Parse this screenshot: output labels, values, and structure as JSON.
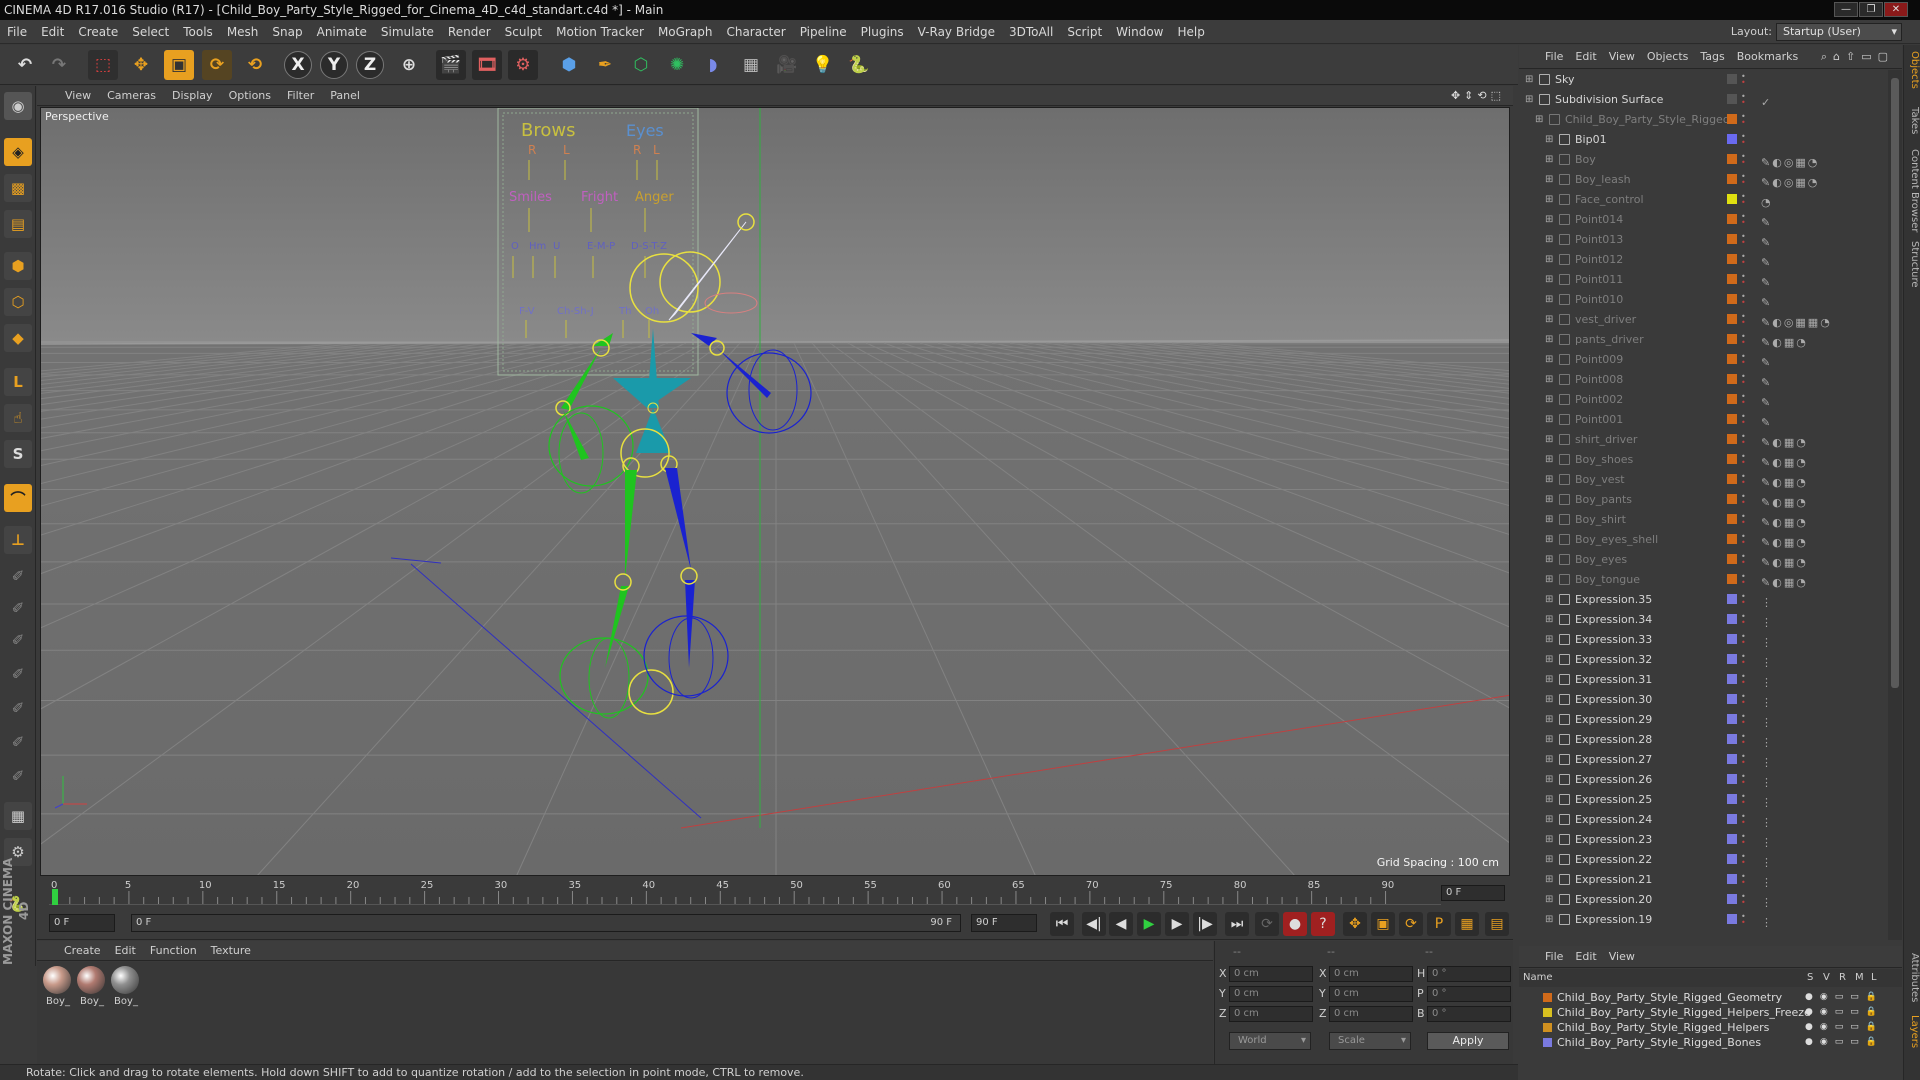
{
  "window": {
    "title": "CINEMA 4D R17.016 Studio (R17) - [Child_Boy_Party_Style_Rigged_for_Cinema_4D_c4d_standart.c4d *] - Main"
  },
  "menubar": {
    "items": [
      "File",
      "Edit",
      "Create",
      "Select",
      "Tools",
      "Mesh",
      "Snap",
      "Animate",
      "Simulate",
      "Render",
      "Sculpt",
      "Motion Tracker",
      "MoGraph",
      "Character",
      "Pipeline",
      "Plugins",
      "V-Ray Bridge",
      "3DToAll",
      "Script",
      "Window",
      "Help"
    ],
    "layout_label": "Layout:",
    "layout_value": "Startup (User)"
  },
  "toolbar": {
    "axis_x": "X",
    "axis_y": "Y",
    "axis_z": "Z"
  },
  "viewport": {
    "menu": [
      "View",
      "Cameras",
      "Display",
      "Options",
      "Filter",
      "Panel"
    ],
    "label": "Perspective",
    "grid_spacing": "Grid Spacing : 100 cm",
    "hud_texts": [
      "Brows",
      "Eyes",
      "R",
      "L",
      "R",
      "L",
      "Smiles",
      "Fright",
      "Anger",
      "O",
      "Hm",
      "U",
      "E-M-P",
      "D-S-T-Z",
      "F-V",
      "Ch-Sh-J",
      "Th",
      "Oh"
    ]
  },
  "timeline": {
    "ticks": [
      "0",
      "5",
      "10",
      "15",
      "20",
      "25",
      "30",
      "35",
      "40",
      "45",
      "50",
      "55",
      "60",
      "65",
      "70",
      "75",
      "80",
      "85",
      "90"
    ],
    "current_frame": "0 F",
    "frame_end": "0 F"
  },
  "transport": {
    "start_field": "0 F",
    "range_start": "0 F",
    "range_end": "90 F",
    "end_field": "90 F"
  },
  "material_manager": {
    "menu": [
      "Create",
      "Edit",
      "Function",
      "Texture"
    ],
    "materials": [
      {
        "label": "Boy_",
        "color": "#c89a8a"
      },
      {
        "label": "Boy_",
        "color": "#b07a70"
      },
      {
        "label": "Boy_",
        "color": "#909090"
      }
    ]
  },
  "coordinates": {
    "header": [
      "--",
      "--",
      "--"
    ],
    "rows": [
      {
        "a": "X",
        "av": "0 cm",
        "b": "X",
        "bv": "0 cm",
        "c": "H",
        "cv": "0 °"
      },
      {
        "a": "Y",
        "av": "0 cm",
        "b": "Y",
        "bv": "0 cm",
        "c": "P",
        "cv": "0 °"
      },
      {
        "a": "Z",
        "av": "0 cm",
        "b": "Z",
        "bv": "0 cm",
        "c": "B",
        "cv": "0 °"
      }
    ],
    "space": "World",
    "mode": "Scale",
    "apply": "Apply"
  },
  "status": {
    "text": "Rotate: Click and drag to rotate elements. Hold down SHIFT to add to quantize rotation / add to the selection in point mode, CTRL to remove."
  },
  "object_manager": {
    "menu": [
      "File",
      "Edit",
      "View",
      "Objects",
      "Tags",
      "Bookmarks"
    ],
    "objects": [
      {
        "name": "Sky",
        "indent": 0,
        "lit": true,
        "tag": "#555555",
        "icons": ""
      },
      {
        "name": "Subdivision Surface",
        "indent": 0,
        "lit": true,
        "tag": "#555555",
        "icons": "✓"
      },
      {
        "name": "Child_Boy_Party_Style_Rigged",
        "indent": 1,
        "lit": false,
        "tag": "#d06a1a",
        "icons": ""
      },
      {
        "name": "Bip01",
        "indent": 2,
        "lit": true,
        "tag": "#6a6af0",
        "icons": ""
      },
      {
        "name": "Boy",
        "indent": 2,
        "lit": false,
        "tag": "#d06a1a",
        "icons": "✎◐◎▦◔"
      },
      {
        "name": "Boy_leash",
        "indent": 2,
        "lit": false,
        "tag": "#d06a1a",
        "icons": "✎◐◎▦◔"
      },
      {
        "name": "Face_control",
        "indent": 2,
        "lit": false,
        "tag": "#e0e010",
        "icons": "◔"
      },
      {
        "name": "Point014",
        "indent": 2,
        "lit": false,
        "tag": "#d06a1a",
        "icons": "✎"
      },
      {
        "name": "Point013",
        "indent": 2,
        "lit": false,
        "tag": "#d06a1a",
        "icons": "✎"
      },
      {
        "name": "Point012",
        "indent": 2,
        "lit": false,
        "tag": "#d06a1a",
        "icons": "✎"
      },
      {
        "name": "Point011",
        "indent": 2,
        "lit": false,
        "tag": "#d06a1a",
        "icons": "✎"
      },
      {
        "name": "Point010",
        "indent": 2,
        "lit": false,
        "tag": "#d06a1a",
        "icons": "✎"
      },
      {
        "name": "vest_driver",
        "indent": 2,
        "lit": false,
        "tag": "#d06a1a",
        "icons": "✎◐◎▦▦◔"
      },
      {
        "name": "pants_driver",
        "indent": 2,
        "lit": false,
        "tag": "#d06a1a",
        "icons": "✎◐▦◔"
      },
      {
        "name": "Point009",
        "indent": 2,
        "lit": false,
        "tag": "#d06a1a",
        "icons": "✎"
      },
      {
        "name": "Point008",
        "indent": 2,
        "lit": false,
        "tag": "#d06a1a",
        "icons": "✎"
      },
      {
        "name": "Point002",
        "indent": 2,
        "lit": false,
        "tag": "#d06a1a",
        "icons": "✎"
      },
      {
        "name": "Point001",
        "indent": 2,
        "lit": false,
        "tag": "#d06a1a",
        "icons": "✎"
      },
      {
        "name": "shirt_driver",
        "indent": 2,
        "lit": false,
        "tag": "#d06a1a",
        "icons": "✎◐▦◔"
      },
      {
        "name": "Boy_shoes",
        "indent": 2,
        "lit": false,
        "tag": "#d06a1a",
        "icons": "✎◐▦◔"
      },
      {
        "name": "Boy_vest",
        "indent": 2,
        "lit": false,
        "tag": "#d06a1a",
        "icons": "✎◐▦◔"
      },
      {
        "name": "Boy_pants",
        "indent": 2,
        "lit": false,
        "tag": "#d06a1a",
        "icons": "✎◐▦◔"
      },
      {
        "name": "Boy_shirt",
        "indent": 2,
        "lit": false,
        "tag": "#d06a1a",
        "icons": "✎◐▦◔"
      },
      {
        "name": "Boy_eyes_shell",
        "indent": 2,
        "lit": false,
        "tag": "#d06a1a",
        "icons": "✎◐▦◔"
      },
      {
        "name": "Boy_eyes",
        "indent": 2,
        "lit": false,
        "tag": "#d06a1a",
        "icons": "✎◐▦◔"
      },
      {
        "name": "Boy_tongue",
        "indent": 2,
        "lit": false,
        "tag": "#d06a1a",
        "icons": "✎◐▦◔"
      },
      {
        "name": "Expression.35",
        "indent": 2,
        "lit": true,
        "tag": "#7a7ae0",
        "icons": "⋮"
      },
      {
        "name": "Expression.34",
        "indent": 2,
        "lit": true,
        "tag": "#7a7ae0",
        "icons": "⋮"
      },
      {
        "name": "Expression.33",
        "indent": 2,
        "lit": true,
        "tag": "#7a7ae0",
        "icons": "⋮"
      },
      {
        "name": "Expression.32",
        "indent": 2,
        "lit": true,
        "tag": "#7a7ae0",
        "icons": "⋮"
      },
      {
        "name": "Expression.31",
        "indent": 2,
        "lit": true,
        "tag": "#7a7ae0",
        "icons": "⋮"
      },
      {
        "name": "Expression.30",
        "indent": 2,
        "lit": true,
        "tag": "#7a7ae0",
        "icons": "⋮"
      },
      {
        "name": "Expression.29",
        "indent": 2,
        "lit": true,
        "tag": "#7a7ae0",
        "icons": "⋮"
      },
      {
        "name": "Expression.28",
        "indent": 2,
        "lit": true,
        "tag": "#7a7ae0",
        "icons": "⋮"
      },
      {
        "name": "Expression.27",
        "indent": 2,
        "lit": true,
        "tag": "#7a7ae0",
        "icons": "⋮"
      },
      {
        "name": "Expression.26",
        "indent": 2,
        "lit": true,
        "tag": "#7a7ae0",
        "icons": "⋮"
      },
      {
        "name": "Expression.25",
        "indent": 2,
        "lit": true,
        "tag": "#7a7ae0",
        "icons": "⋮"
      },
      {
        "name": "Expression.24",
        "indent": 2,
        "lit": true,
        "tag": "#7a7ae0",
        "icons": "⋮"
      },
      {
        "name": "Expression.23",
        "indent": 2,
        "lit": true,
        "tag": "#7a7ae0",
        "icons": "⋮"
      },
      {
        "name": "Expression.22",
        "indent": 2,
        "lit": true,
        "tag": "#7a7ae0",
        "icons": "⋮"
      },
      {
        "name": "Expression.21",
        "indent": 2,
        "lit": true,
        "tag": "#7a7ae0",
        "icons": "⋮"
      },
      {
        "name": "Expression.20",
        "indent": 2,
        "lit": true,
        "tag": "#7a7ae0",
        "icons": "⋮"
      },
      {
        "name": "Expression.19",
        "indent": 2,
        "lit": true,
        "tag": "#7a7ae0",
        "icons": "⋮"
      }
    ]
  },
  "layer_manager": {
    "menu": [
      "File",
      "Edit",
      "View"
    ],
    "header": {
      "name": "Name",
      "s": "S",
      "v": "V",
      "r": "R",
      "m": "M",
      "l": "L"
    },
    "layers": [
      {
        "name": "Child_Boy_Party_Style_Rigged_Geometry",
        "color": "#d06a1a"
      },
      {
        "name": "Child_Boy_Party_Style_Rigged_Helpers_Freeze",
        "color": "#d8c020"
      },
      {
        "name": "Child_Boy_Party_Style_Rigged_Helpers",
        "color": "#d09020"
      },
      {
        "name": "Child_Boy_Party_Style_Rigged_Bones",
        "color": "#7a7ae0"
      }
    ]
  },
  "right_tabs": [
    "Objects",
    "Takes",
    "Content Browser",
    "Structure",
    "Attributes",
    "Layers"
  ],
  "colors": {
    "bone_green": "#1fc41f",
    "bone_blue": "#1a22d0",
    "ctrl_yellow": "#e8e040",
    "ctrl_teal": "#1a9aaa",
    "viewport_bg": "#7c7c7c"
  }
}
